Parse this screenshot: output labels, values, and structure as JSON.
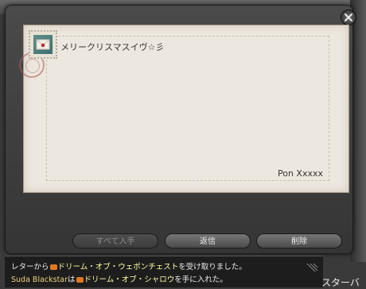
{
  "letter": {
    "body": "メリークリスマスイヴ☆彡",
    "signature": "Pon Xxxxx"
  },
  "buttons": {
    "take_all": "すべて入手",
    "reply": "返信",
    "delete": "削除"
  },
  "chat": {
    "line1": {
      "prefix": "レターから",
      "item": "ドリーム・オブ・ウェポンチェスト",
      "suffix": "を受け取りました。"
    },
    "line2": {
      "player": "Suda Blackstar",
      "particle": "は",
      "item": "ドリーム・オブ・シャロウ",
      "suffix": "を手に入れた。"
    }
  },
  "side_label": "スターバ",
  "icons": {
    "close": "close-icon",
    "stamp": "stamp-icon",
    "item": "item-icon"
  },
  "colors": {
    "paper": "#ece7df",
    "player_name": "#e8d27a",
    "item_link": "#ffffa8",
    "item_icon": "#e07820"
  }
}
